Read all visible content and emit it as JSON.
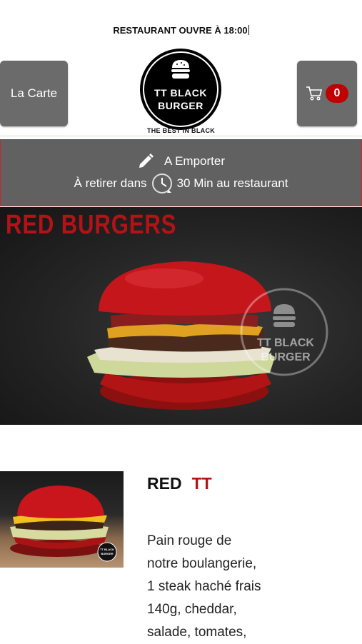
{
  "notice": {
    "text": "RESTAURANT OUVRE À 18:00"
  },
  "nav": {
    "menu_label": "La Carte",
    "cart_count": "0"
  },
  "logo": {
    "line1": "TT BLACK",
    "line2": "BURGER",
    "tagline": "THE BEST IN BLACK"
  },
  "order": {
    "mode": "A Emporter",
    "pickup_prefix": "À retirer dans",
    "pickup_suffix": "30 Min au restaurant"
  },
  "banner": {
    "title": "RED BURGERS",
    "watermark_line1": "TT BLACK",
    "watermark_line2": "BURGER"
  },
  "product": {
    "name": "RED",
    "name_accent": "TT",
    "description_lines": [
      "Pain rouge de",
      "notre boulangerie,",
      "1 steak haché frais",
      "140g, cheddar,",
      "salade, tomates,"
    ],
    "image_logo_line1": "TT BLACK",
    "image_logo_line2": "BURGER"
  },
  "colors": {
    "accent_red": "#b31217",
    "button_gray": "#6b6b6b",
    "badge_red": "#c00000"
  },
  "icons": [
    "pencil-icon",
    "clock-icon",
    "cart-icon",
    "burger-icon"
  ]
}
